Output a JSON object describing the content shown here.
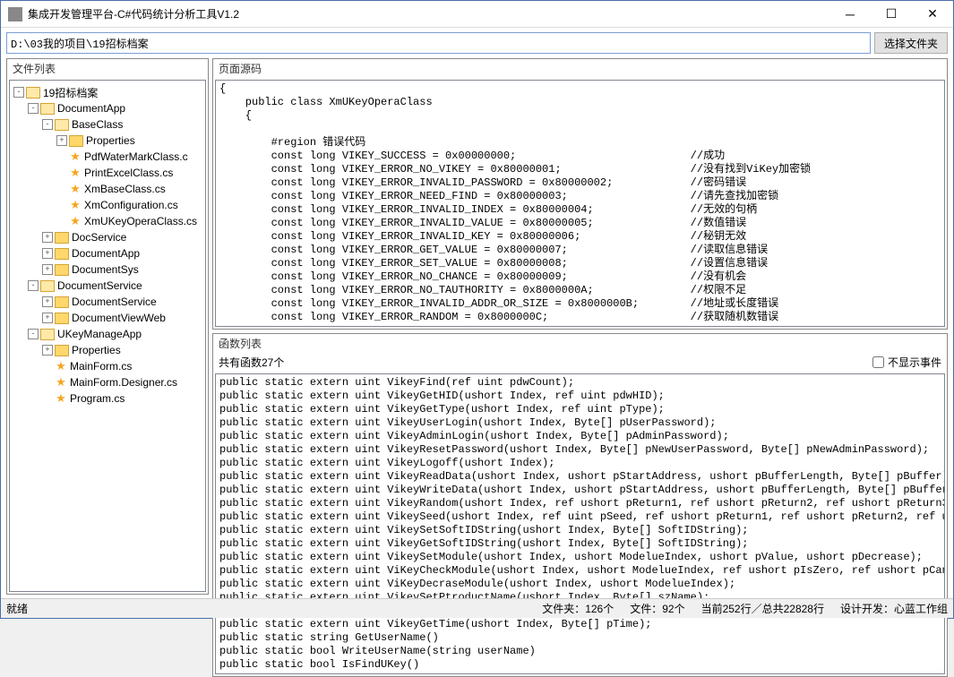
{
  "window": {
    "title": "集成开发管理平台-C#代码统计分析工具V1.2"
  },
  "pathbar": {
    "value": "D:\\03我的项目\\19招标档案",
    "browse": "选择文件夹"
  },
  "panels": {
    "file_list": "文件列表",
    "page_source": "页面源码",
    "func_list": "函数列表"
  },
  "tree": [
    {
      "indent": 0,
      "toggle": "-",
      "icon": "folder-open",
      "label": "19招标档案"
    },
    {
      "indent": 1,
      "toggle": "-",
      "icon": "folder-open",
      "label": "DocumentApp"
    },
    {
      "indent": 2,
      "toggle": "-",
      "icon": "folder-open",
      "label": "BaseClass"
    },
    {
      "indent": 3,
      "toggle": "+",
      "icon": "folder",
      "label": "Properties"
    },
    {
      "indent": 3,
      "toggle": "",
      "icon": "star",
      "label": "PdfWaterMarkClass.c"
    },
    {
      "indent": 3,
      "toggle": "",
      "icon": "star",
      "label": "PrintExcelClass.cs"
    },
    {
      "indent": 3,
      "toggle": "",
      "icon": "star",
      "label": "XmBaseClass.cs"
    },
    {
      "indent": 3,
      "toggle": "",
      "icon": "star",
      "label": "XmConfiguration.cs"
    },
    {
      "indent": 3,
      "toggle": "",
      "icon": "star",
      "label": "XmUKeyOperaClass.cs"
    },
    {
      "indent": 2,
      "toggle": "+",
      "icon": "folder",
      "label": "DocService"
    },
    {
      "indent": 2,
      "toggle": "+",
      "icon": "folder",
      "label": "DocumentApp"
    },
    {
      "indent": 2,
      "toggle": "+",
      "icon": "folder",
      "label": "DocumentSys"
    },
    {
      "indent": 1,
      "toggle": "-",
      "icon": "folder-open",
      "label": "DocumentService"
    },
    {
      "indent": 2,
      "toggle": "+",
      "icon": "folder",
      "label": "DocumentService"
    },
    {
      "indent": 2,
      "toggle": "+",
      "icon": "folder",
      "label": "DocumentViewWeb"
    },
    {
      "indent": 1,
      "toggle": "-",
      "icon": "folder-open",
      "label": "UKeyManageApp"
    },
    {
      "indent": 2,
      "toggle": "+",
      "icon": "folder",
      "label": "Properties"
    },
    {
      "indent": 2,
      "toggle": "",
      "icon": "star",
      "label": "MainForm.cs"
    },
    {
      "indent": 2,
      "toggle": "",
      "icon": "star",
      "label": "MainForm.Designer.cs"
    },
    {
      "indent": 2,
      "toggle": "",
      "icon": "star",
      "label": "Program.cs"
    }
  ],
  "source_code": "{\n    public class XmUKeyOperaClass\n    {\n\n        #region 错误代码\n        const long VIKEY_SUCCESS = 0x00000000;                           //成功\n        const long VIKEY_ERROR_NO_VIKEY = 0x80000001;                    //没有找到ViKey加密锁\n        const long VIKEY_ERROR_INVALID_PASSWORD = 0x80000002;            //密码错误\n        const long VIKEY_ERROR_NEED_FIND = 0x80000003;                   //请先查找加密锁\n        const long VIKEY_ERROR_INVALID_INDEX = 0x80000004;               //无效的句柄\n        const long VIKEY_ERROR_INVALID_VALUE = 0x80000005;               //数值错误\n        const long VIKEY_ERROR_INVALID_KEY = 0x80000006;                 //秘钥无效\n        const long VIKEY_ERROR_GET_VALUE = 0x80000007;                   //读取信息错误\n        const long VIKEY_ERROR_SET_VALUE = 0x80000008;                   //设置信息错误\n        const long VIKEY_ERROR_NO_CHANCE = 0x80000009;                   //没有机会\n        const long VIKEY_ERROR_NO_TAUTHORITY = 0x8000000A;               //权限不足\n        const long VIKEY_ERROR_INVALID_ADDR_OR_SIZE = 0x8000000B;        //地址或长度错误\n        const long VIKEY_ERROR_RANDOM = 0x8000000C;                      //获取随机数错误",
  "func": {
    "count_label": "共有函数27个",
    "hide_events_label": "不显示事件",
    "hide_events_checked": false,
    "list": "public static extern uint VikeyFind(ref uint pdwCount);\npublic static extern uint VikeyGetHID(ushort Index, ref uint pdwHID);\npublic static extern uint VikeyGetType(ushort Index, ref uint pType);\npublic static extern uint VikeyUserLogin(ushort Index, Byte[] pUserPassword);\npublic static extern uint VikeyAdminLogin(ushort Index, Byte[] pAdminPassword);\npublic static extern uint VikeyResetPassword(ushort Index, Byte[] pNewUserPassword, Byte[] pNewAdminPassword);\npublic static extern uint VikeyLogoff(ushort Index);\npublic static extern uint VikeyReadData(ushort Index, ushort pStartAddress, ushort pBufferLength, Byte[] pBuffer);\npublic static extern uint VikeyWriteData(ushort Index, ushort pStartAddress, ushort pBufferLength, Byte[] pBuffer);\npublic static extern uint VikeyRandom(ushort Index, ref ushort pReturn1, ref ushort pReturn2, ref ushort pReturn3, ref ushort pReturn4);\npublic static extern uint VikeySeed(ushort Index, ref uint pSeed, ref ushort pReturn1, ref ushort pReturn2, ref ushort pReturn3, ref ushort pReturn4);\npublic static extern uint VikeySetSoftIDString(ushort Index, Byte[] SoftIDString);\npublic static extern uint VikeyGetSoftIDString(ushort Index, Byte[] SoftIDString);\npublic static extern uint VikeySetModule(ushort Index, ushort ModelueIndex, ushort pValue, ushort pDecrease);\npublic static extern uint ViKeyCheckModule(ushort Index, ushort ModelueIndex, ref ushort pIsZero, ref ushort pCanDecrase);\npublic static extern uint ViKeyDecraseModule(ushort Index, ushort ModelueIndex);\npublic static extern uint VikeySetPtroductName(ushort Index, Byte[] szName);\npublic static extern uint VikeyGetPtroductName(ushort Index, Byte[] szName);\npublic static extern uint VikeyGetTime(ushort Index, Byte[] pTime);\npublic static string GetUserName()\npublic static bool WriteUserName(string userName)\npublic static bool IsFindUKey()"
  },
  "status": {
    "ready": "就绪",
    "folders": "文件夹：126个",
    "files": "文件：92个",
    "lines": "当前252行／总共22828行",
    "credit": "设计开发：心蓝工作组"
  }
}
